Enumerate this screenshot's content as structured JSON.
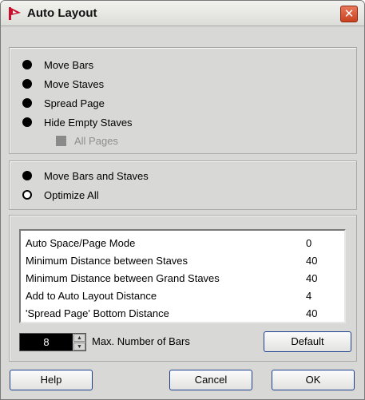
{
  "window": {
    "title": "Auto Layout",
    "close_glyph": "✕",
    "app_icon": "cubase-logo-icon"
  },
  "layout_options": [
    {
      "label": "Move Bars",
      "selected": true
    },
    {
      "label": "Move Staves",
      "selected": true
    },
    {
      "label": "Spread Page",
      "selected": true
    },
    {
      "label": "Hide Empty Staves",
      "selected": true
    }
  ],
  "all_pages": {
    "label": "All Pages",
    "enabled": false
  },
  "mode_options": [
    {
      "label": "Move Bars and Staves",
      "selected": true
    },
    {
      "label": "Optimize All",
      "selected": false
    }
  ],
  "settings": [
    {
      "name": "Auto Space/Page Mode",
      "value": "0"
    },
    {
      "name": "Minimum Distance between Staves",
      "value": "40"
    },
    {
      "name": "Minimum Distance between Grand Staves",
      "value": "40"
    },
    {
      "name": "Add to Auto Layout Distance",
      "value": "4"
    },
    {
      "name": "'Spread Page' Bottom Distance",
      "value": "40"
    }
  ],
  "max_bars": {
    "value": "8",
    "label": "Max. Number of Bars"
  },
  "buttons": {
    "default": "Default",
    "help": "Help",
    "cancel": "Cancel",
    "ok": "OK"
  },
  "colors": {
    "accent": "#c8102e",
    "close": "#d24e2b",
    "button_border": "#1b3e8c"
  }
}
